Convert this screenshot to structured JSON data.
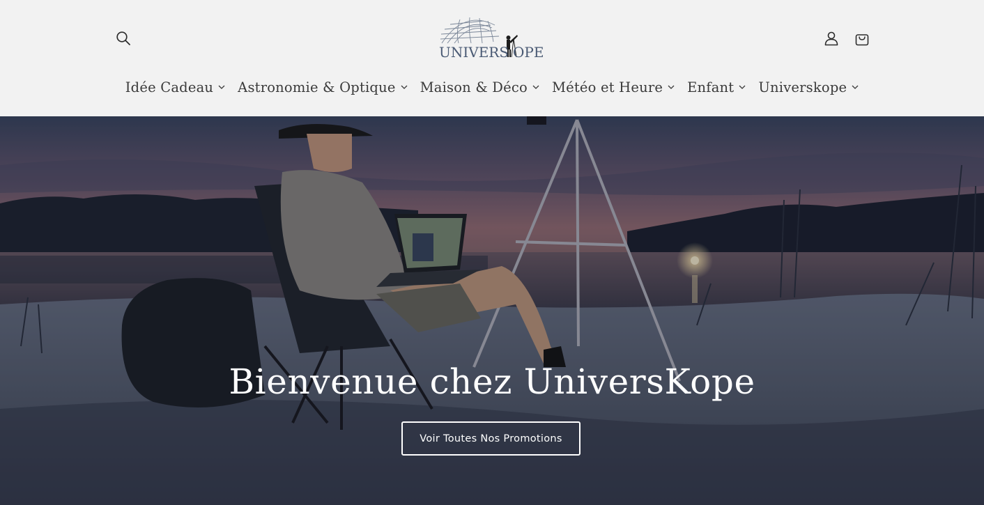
{
  "header": {
    "logo": {
      "text_left": "UNIVERS",
      "text_right": "OPE",
      "icon": "globe-telescope-logo"
    },
    "icons": {
      "search": "search-icon",
      "account": "user-icon",
      "cart": "bag-icon"
    }
  },
  "nav": {
    "items": [
      {
        "label": "Idée Cadeau"
      },
      {
        "label": "Astronomie & Optique"
      },
      {
        "label": "Maison & Déco"
      },
      {
        "label": "Météo et Heure"
      },
      {
        "label": "Enfant"
      },
      {
        "label": "Universkope"
      }
    ]
  },
  "hero": {
    "title": "Bienvenue chez UniversKope",
    "button_label": "Voir Toutes Nos Promotions"
  },
  "colors": {
    "header_bg": "#f2f2f2",
    "text": "#3a3a3a",
    "logo_blue": "#4a5a74",
    "hero_text": "#ffffff"
  }
}
